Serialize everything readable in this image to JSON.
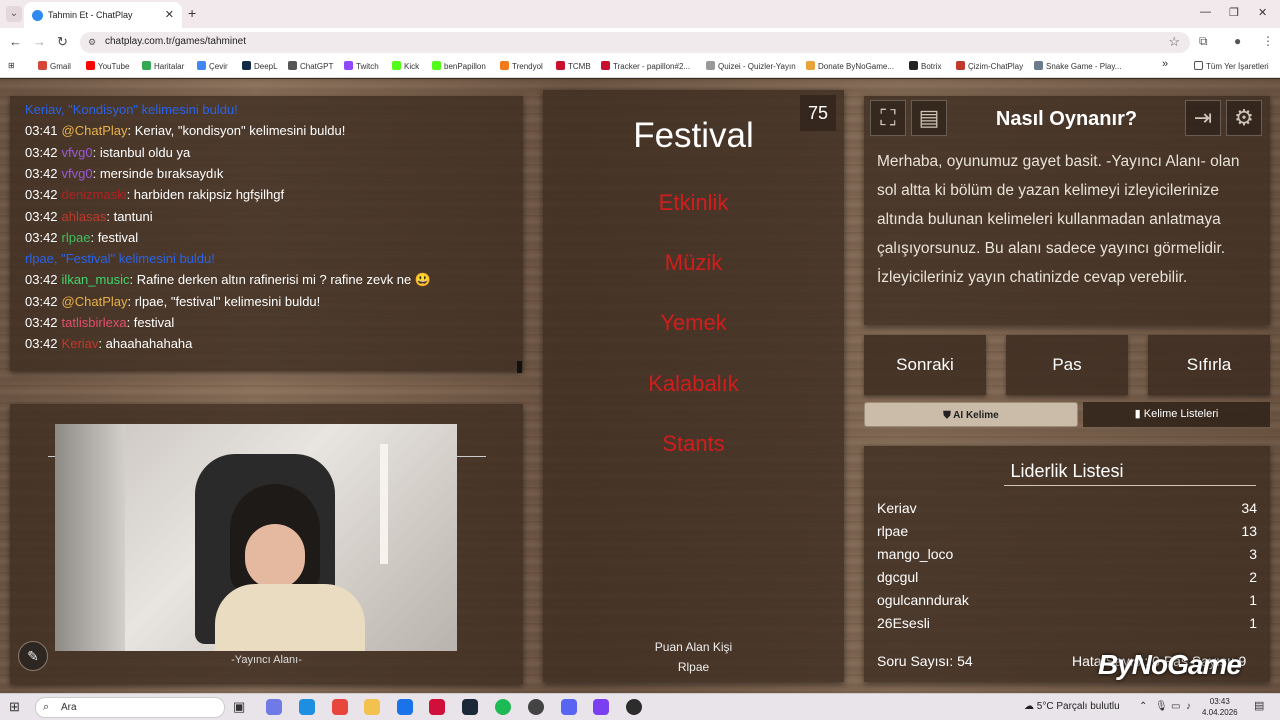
{
  "browser": {
    "tab_title": "Tahmin Et - ChatPlay",
    "url": "chatplay.com.tr/games/tahminet",
    "bookmarks": [
      "Gmail",
      "YouTube",
      "Haritalar",
      "Çevir",
      "DeepL",
      "ChatGPT",
      "Twitch",
      "Kick",
      "benPapillon",
      "Trendyol",
      "TCMB",
      "Tracker - papillon#2...",
      "Quizei - Quizler-Yayın",
      "Donate ByNoGame...",
      "Botrix",
      "Çizim-ChatPlay",
      "Snake Game - Play..."
    ],
    "bookmarks_more": "»",
    "all_bookmarks": "Tüm Yer İşaretleri"
  },
  "chat": {
    "lines": [
      {
        "time": "",
        "user": "Keriav, \"Kondisyon\" kelimesini buldu!",
        "user_color": "#2a63e8",
        "text": ""
      },
      {
        "time": "03:41",
        "user": "@ChatPlay",
        "user_color": "#e8b24a",
        "text": ": Keriav, \"kondisyon\" kelimesini buldu!"
      },
      {
        "time": "03:42",
        "user": "vfvg0",
        "user_color": "#9b59d8",
        "text": ": istanbul oldu ya"
      },
      {
        "time": "03:42",
        "user": "vfvg0",
        "user_color": "#9b59d8",
        "text": ": mersinde bıraksaydık"
      },
      {
        "time": "03:42",
        "user": "denizmaski",
        "user_color": "#b22222",
        "text": ": harbiden rakipsiz hgfşilhgf"
      },
      {
        "time": "03:42",
        "user": "ahlasas",
        "user_color": "#c0392b",
        "text": ": tantuni"
      },
      {
        "time": "03:42",
        "user": "rlpae",
        "user_color": "#3fbf5f",
        "text": ": festival"
      },
      {
        "time": "",
        "user": "rlpae, \"Festival\" kelimesini buldu!",
        "user_color": "#2a63e8",
        "text": ""
      },
      {
        "time": "03:42",
        "user": "ilkan_music",
        "user_color": "#42d66a",
        "text": ": Rafine derken altın rafinerisi mi ? rafine zevk ne 😃"
      },
      {
        "time": "03:42",
        "user": "@ChatPlay",
        "user_color": "#e8b24a",
        "text": ": rlpae, \"festival\" kelimesini buldu!"
      },
      {
        "time": "03:42",
        "user": "tatlisbirlexa",
        "user_color": "#e0506a",
        "text": ": festival"
      },
      {
        "time": "03:42",
        "user": "Keriav",
        "user_color": "#c0392b",
        "text": ": ahaahahahaha"
      }
    ]
  },
  "cam": {
    "caption": "-Yayıncı Alanı-"
  },
  "card": {
    "timer": "75",
    "word": "Festival",
    "taboo_words": [
      "Etkinlik",
      "Müzik",
      "Yemek",
      "Kalabalık",
      "Stants"
    ],
    "scorer_label": "Puan Alan Kişi",
    "scorer_name": "Rlpae"
  },
  "howto": {
    "title": "Nasıl Oynanır?",
    "text": "Merhaba, oyunumuz gayet basit. -Yayıncı Alanı- olan sol altta ki bölüm de yazan kelimeyi izleyicilerinize altında bulunan kelimeleri kullanmadan anlatmaya çalışıyorsunuz. Bu alanı sadece yayıncı görmelidir. İzleyicileriniz yayın chatinizde cevap verebilir."
  },
  "controls": {
    "next": "Sonraki",
    "pass": "Pas",
    "reset": "Sıfırla",
    "ai_word": "AI Kelime",
    "word_lists": "Kelime Listeleri"
  },
  "leaderboard": {
    "title": "Liderlik Listesi",
    "rows": [
      {
        "name": "Keriav",
        "score": "34"
      },
      {
        "name": "rlpae",
        "score": "13"
      },
      {
        "name": "mango_loco",
        "score": "3"
      },
      {
        "name": "dgcgul",
        "score": "2"
      },
      {
        "name": "ogulcanndurak",
        "score": "1"
      },
      {
        "name": "26Esesli",
        "score": "1"
      }
    ],
    "question_count": "Soru Sayısı: 54",
    "right_stats": "Hata Sayısı: 0   Pas Sayısı: 9"
  },
  "watermark": "ByNoGame",
  "taskbar": {
    "search": "Ara",
    "weather": "5°C  Parçalı bulutlu",
    "time": "03:43",
    "date": "4.04.2026"
  },
  "colors": {
    "taboo": "#d31c1c",
    "panel": "#3c2c20"
  }
}
